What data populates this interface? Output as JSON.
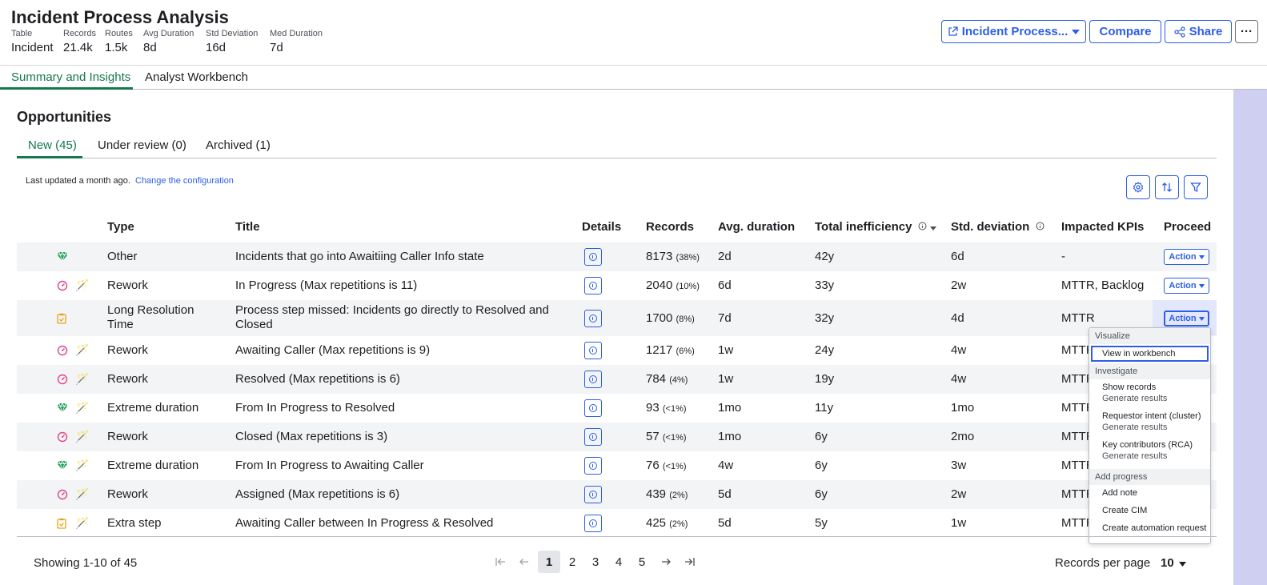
{
  "header": {
    "title": "Incident Process Analysis",
    "stats": [
      {
        "label": "Table",
        "value": "Incident"
      },
      {
        "label": "Records",
        "value": "21.4k"
      },
      {
        "label": "Routes",
        "value": "1.5k"
      },
      {
        "label": "Avg Duration",
        "value": "8d"
      },
      {
        "label": "Std Deviation",
        "value": "16d"
      },
      {
        "label": "Med Duration",
        "value": "7d"
      }
    ],
    "process_button": "Incident Process...",
    "compare_button": "Compare",
    "share_button": "Share",
    "more_button": "···"
  },
  "top_tabs": [
    "Summary and Insights",
    "Analyst Workbench"
  ],
  "section": {
    "title": "Opportunities",
    "tabs": [
      "New (45)",
      "Under review (0)",
      "Archived (1)"
    ],
    "updated_text": "Last updated a month ago.",
    "config_link": "Change the configuration"
  },
  "table": {
    "columns": [
      "Type",
      "Title",
      "Details",
      "Records",
      "Avg. duration",
      "Total inefficiency",
      "Std. deviation",
      "Impacted KPIs",
      "Proceed"
    ],
    "action_label": "Action",
    "rows": [
      {
        "icon": "gem-icon",
        "type": "Other",
        "type2": "",
        "title": "Incidents that go into Awaitiing Caller Info state",
        "title2": "",
        "records": "8173",
        "pct": "(38%)",
        "avg": "2d",
        "ineff": "42y",
        "std": "6d",
        "kpi": "-"
      },
      {
        "icon": "gauge-icon",
        "type": "Rework",
        "type2": "",
        "title": "In Progress (Max repetitions is 11)",
        "title2": "",
        "records": "2040",
        "pct": "(10%)",
        "avg": "6d",
        "ineff": "33y",
        "std": "2w",
        "kpi": "MTTR, Backlog"
      },
      {
        "icon": "clipboard-icon",
        "type": "Long Resolution",
        "type2": "Time",
        "title": "Process step missed: Incidents go directly to Resolved and",
        "title2": "Closed",
        "records": "1700",
        "pct": "(8%)",
        "avg": "7d",
        "ineff": "32y",
        "std": "4d",
        "kpi": "MTTR"
      },
      {
        "icon": "gauge-icon",
        "type": "Rework",
        "type2": "",
        "title": "Awaiting Caller (Max repetitions is 9)",
        "title2": "",
        "records": "1217",
        "pct": "(6%)",
        "avg": "1w",
        "ineff": "24y",
        "std": "4w",
        "kpi": "MTTR"
      },
      {
        "icon": "gauge-icon",
        "type": "Rework",
        "type2": "",
        "title": "Resolved (Max repetitions is 6)",
        "title2": "",
        "records": "784",
        "pct": "(4%)",
        "avg": "1w",
        "ineff": "19y",
        "std": "4w",
        "kpi": "MTTR"
      },
      {
        "icon": "gem-icon",
        "type": "Extreme duration",
        "type2": "",
        "title": "From In Progress to Resolved",
        "title2": "",
        "records": "93",
        "pct": "(<1%)",
        "avg": "1mo",
        "ineff": "11y",
        "std": "1mo",
        "kpi": "MTTR"
      },
      {
        "icon": "gauge-icon",
        "type": "Rework",
        "type2": "",
        "title": "Closed (Max repetitions is 3)",
        "title2": "",
        "records": "57",
        "pct": "(<1%)",
        "avg": "1mo",
        "ineff": "6y",
        "std": "2mo",
        "kpi": "MTTR"
      },
      {
        "icon": "gem-icon",
        "type": "Extreme duration",
        "type2": "",
        "title": "From In Progress to Awaiting Caller",
        "title2": "",
        "records": "76",
        "pct": "(<1%)",
        "avg": "4w",
        "ineff": "6y",
        "std": "3w",
        "kpi": "MTTR"
      },
      {
        "icon": "gauge-icon",
        "type": "Rework",
        "type2": "",
        "title": "Assigned (Max repetitions is 6)",
        "title2": "",
        "records": "439",
        "pct": "(2%)",
        "avg": "5d",
        "ineff": "6y",
        "std": "2w",
        "kpi": "MTTR"
      },
      {
        "icon": "clipboard-icon",
        "type": "Extra step",
        "type2": "",
        "title": "Awaiting Caller between In Progress & Resolved",
        "title2": "",
        "records": "425",
        "pct": "(2%)",
        "avg": "5d",
        "ineff": "5y",
        "std": "1w",
        "kpi": "MTTR"
      }
    ]
  },
  "menu": {
    "group_visualize": "Visualize",
    "view_workbench": "View in workbench",
    "group_investigate": "Investigate",
    "show_records": "Show records",
    "requestor_intent": "Requestor intent (cluster)",
    "key_contributors": "Key contributors (RCA)",
    "generate_results": "Generate results",
    "group_progress": "Add progress",
    "add_note": "Add note",
    "create_cim": "Create CIM",
    "create_automation": "Create automation request"
  },
  "footer": {
    "showing": "Showing 1-10 of 45",
    "pages": [
      "1",
      "2",
      "3",
      "4",
      "5"
    ],
    "records_per_page_label": "Records per page",
    "records_per_page_value": "10"
  },
  "colors": {
    "accent": "#2c5ee8",
    "tab_active": "#16784d",
    "gem": "#1f9e5a",
    "gauge": "#e0468a",
    "clipboard": "#e8a317",
    "band": "#cfd0f1"
  }
}
